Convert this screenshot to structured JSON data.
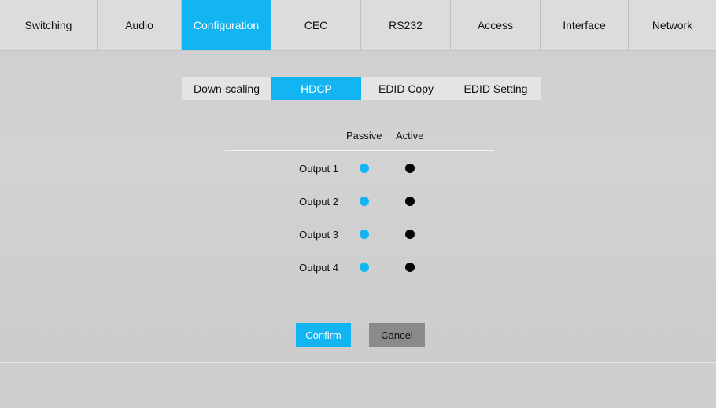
{
  "nav": {
    "tabs": [
      {
        "label": "Switching"
      },
      {
        "label": "Audio"
      },
      {
        "label": "Configuration"
      },
      {
        "label": "CEC"
      },
      {
        "label": "RS232"
      },
      {
        "label": "Access"
      },
      {
        "label": "Interface"
      },
      {
        "label": "Network"
      }
    ],
    "active": "Configuration"
  },
  "subnav": {
    "tabs": [
      {
        "label": "Down-scaling"
      },
      {
        "label": "HDCP"
      },
      {
        "label": "EDID Copy"
      },
      {
        "label": "EDID Setting"
      }
    ],
    "active": "HDCP"
  },
  "hdcp": {
    "col_passive": "Passive",
    "col_active": "Active",
    "outputs": [
      {
        "label": "Output 1",
        "mode": "Passive"
      },
      {
        "label": "Output 2",
        "mode": "Passive"
      },
      {
        "label": "Output 3",
        "mode": "Passive"
      },
      {
        "label": "Output 4",
        "mode": "Passive"
      }
    ]
  },
  "buttons": {
    "confirm": "Confirm",
    "cancel": "Cancel"
  },
  "colors": {
    "accent": "#12b4f2",
    "selected_dot": "#12b4f2",
    "unselected_dot": "#050505"
  }
}
